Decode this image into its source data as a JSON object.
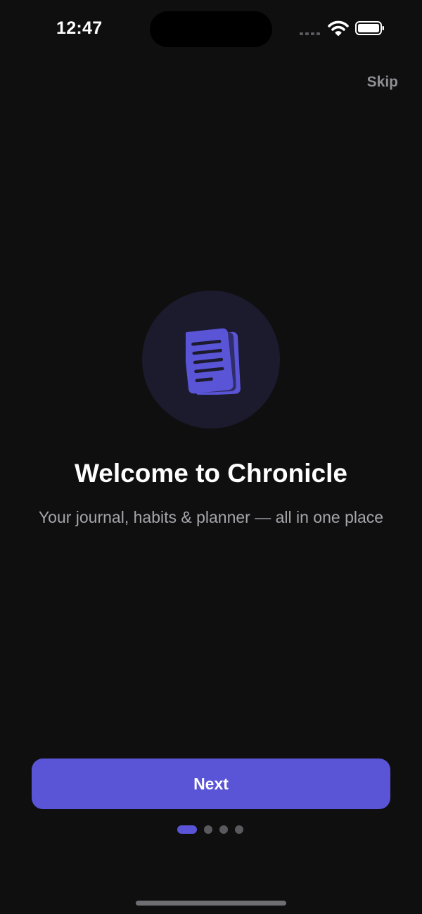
{
  "status_bar": {
    "time": "12:47",
    "icons": [
      "cellular-signal-icon",
      "wifi-icon",
      "battery-icon"
    ]
  },
  "header": {
    "skip_label": "Skip"
  },
  "hero": {
    "icon": "document-stack-icon",
    "title": "Welcome to Chronicle",
    "subtitle": "Your journal, habits & planner — all in one place"
  },
  "actions": {
    "next_label": "Next"
  },
  "pagination": {
    "total_pages": 4,
    "current_page": 1
  },
  "colors": {
    "background": "#0f0f10",
    "accent": "#5a54d6",
    "icon_circle": "#1c1b2e",
    "secondary_text": "#a5a5aa",
    "muted": "#8e8e93"
  }
}
